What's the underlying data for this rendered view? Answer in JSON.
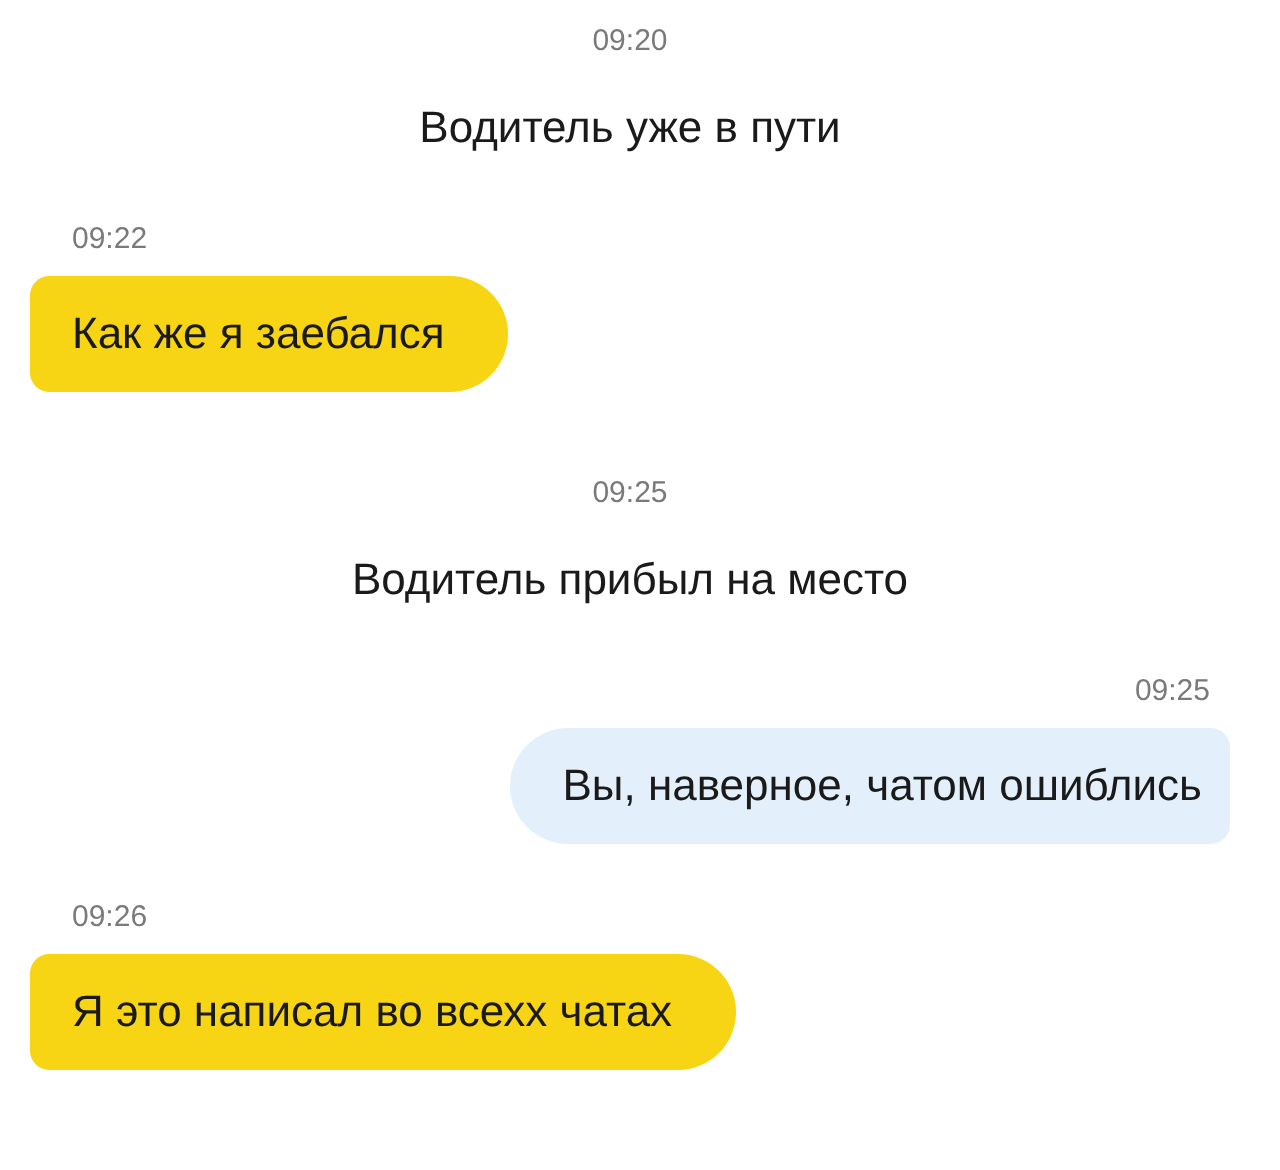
{
  "messages": [
    {
      "kind": "system",
      "time": "09:20",
      "text": "Водитель уже в пути"
    },
    {
      "kind": "incoming",
      "time": "09:22",
      "text": "Как же я заебался"
    },
    {
      "kind": "system",
      "time": "09:25",
      "text": "Водитель прибыл на место"
    },
    {
      "kind": "outgoing",
      "time": "09:25",
      "text": "Вы, наверное, чатом ошиблись"
    },
    {
      "kind": "incoming",
      "time": "09:26",
      "text": "Я это написал во всехх чатах"
    }
  ]
}
